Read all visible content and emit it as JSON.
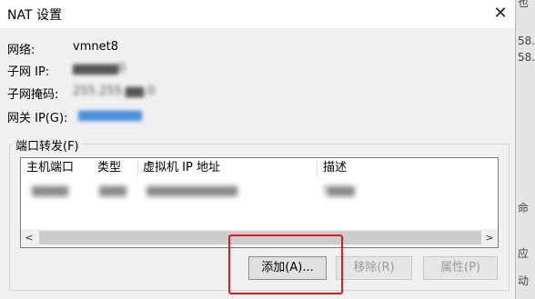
{
  "dialog": {
    "title": "NAT 设置",
    "close_glyph": "✕"
  },
  "fields": {
    "network_label": "网络:",
    "network_value": "vmnet8",
    "subnet_ip_label": "子网 IP:",
    "subnet_ip_value": "▆▆▆▆▆0",
    "subnet_mask_label": "子网掩码:",
    "subnet_mask_value": "255.255.▆▆.0",
    "gateway_label": "网关 IP(G):",
    "gateway_value": "▆▆▆▆▆▆▆"
  },
  "port_forwarding": {
    "group_label": "端口转发(F)",
    "columns": [
      "主机端口",
      "类型",
      "虚拟机 IP 地址",
      "描述"
    ],
    "rows": [
      {
        "host_port": "▆▆▆▆",
        "type": "▆▆▆",
        "vm_ip": "▆▆▆▆▆▆▆▆▆▆",
        "description": "f▆▆▆"
      }
    ],
    "scroll_left_glyph": "<",
    "scroll_right_glyph": ">"
  },
  "buttons": {
    "add": "添加(A)...",
    "remove": "移除(R)",
    "properties": "属性(P)"
  },
  "background_window": {
    "fragments": [
      "也",
      "58.",
      "58.",
      "命",
      "应",
      "动"
    ]
  },
  "colors": {
    "highlight": "#e01b1b"
  }
}
